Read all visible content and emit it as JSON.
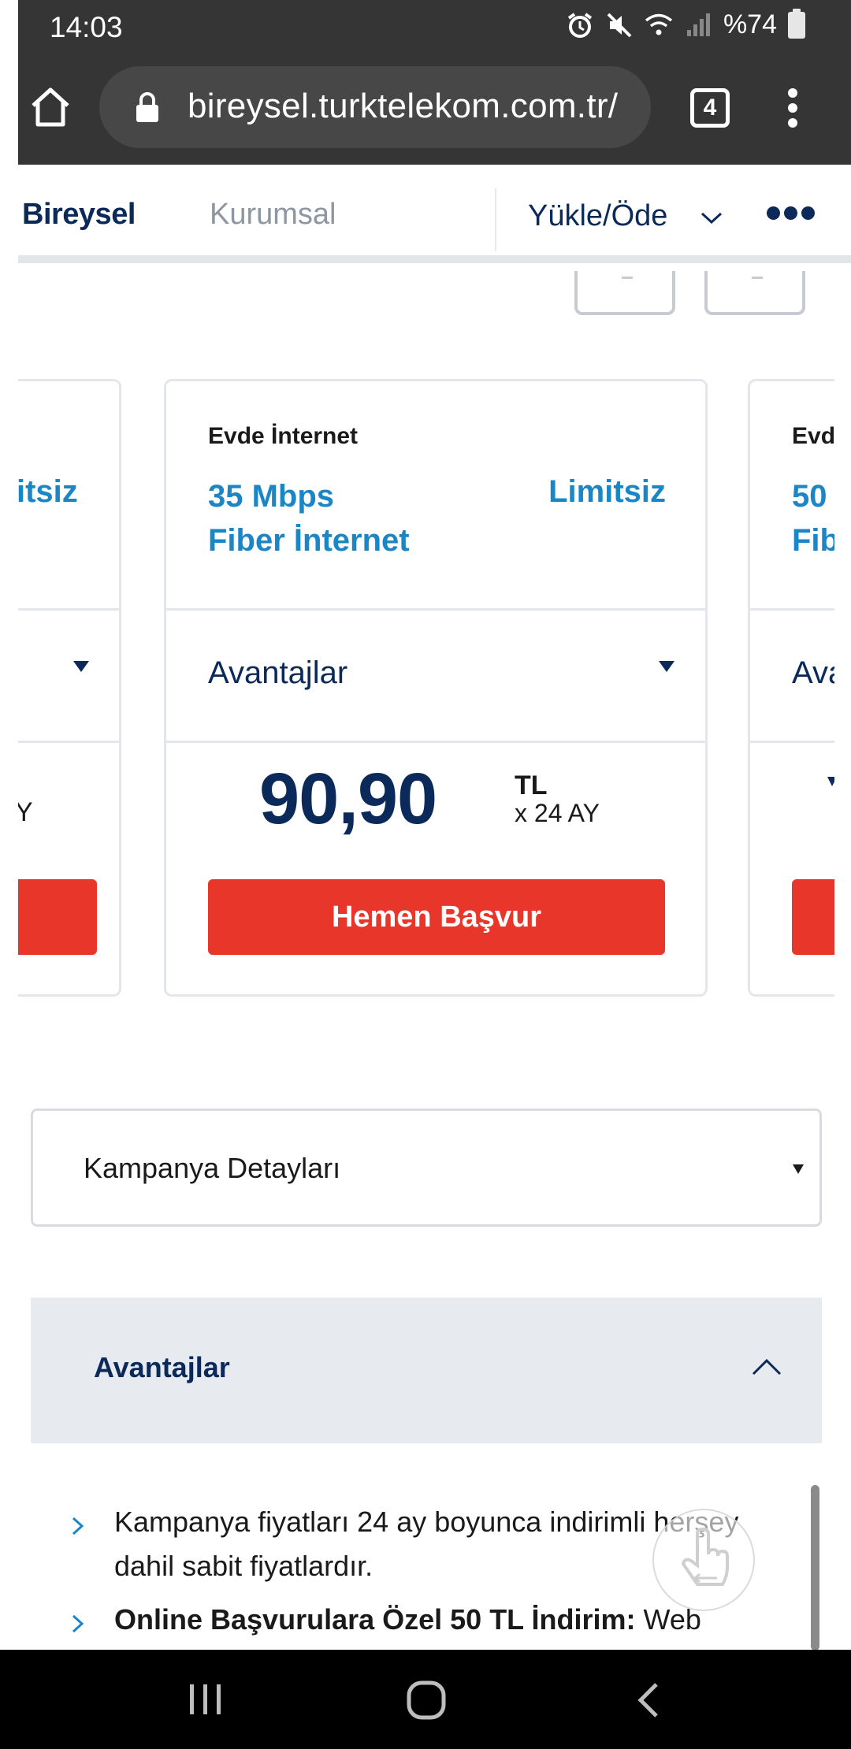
{
  "status_bar": {
    "time": "14:03",
    "battery": "%74",
    "icons": [
      "alarm-icon",
      "mute-icon",
      "wifi-icon",
      "signal-icon",
      "battery-icon"
    ]
  },
  "browser": {
    "url": "bireysel.turktelekom.com.tr/",
    "tab_count": "4"
  },
  "site_nav": {
    "bireysel": "Bireysel",
    "kurumsal": "Kurumsal",
    "yukle_ode": "Yükle/Öde"
  },
  "cards": [
    {
      "speed_line1": "",
      "limit": "itsiz",
      "period": "Y"
    },
    {
      "type": "Evde İnternet",
      "speed_line1": "35 Mbps",
      "speed_line2": "Fiber İnternet",
      "limit": "Limitsiz",
      "advantages": "Avantajlar",
      "price": "90,90",
      "currency": "TL",
      "period": "x 24 AY",
      "cta": "Hemen Başvur"
    },
    {
      "type": "Evd",
      "speed_line1": "50",
      "speed_line2": "Fib",
      "advantages": "Ava"
    }
  ],
  "campaign": {
    "label": "Kampanya Detayları"
  },
  "advantages": {
    "title": "Avantajlar",
    "items": [
      {
        "bold": "",
        "text": "Kampanya fiyatları 24 ay boyunca indirimli herşey dahil sabit fiyatlardır."
      },
      {
        "bold": "Online Başvurulara Özel 50 TL İndirim:",
        "text": " Web"
      }
    ]
  },
  "colors": {
    "brand_navy": "#0b2a59",
    "accent_blue": "#1b86c6",
    "cta_red": "#e8362a"
  }
}
